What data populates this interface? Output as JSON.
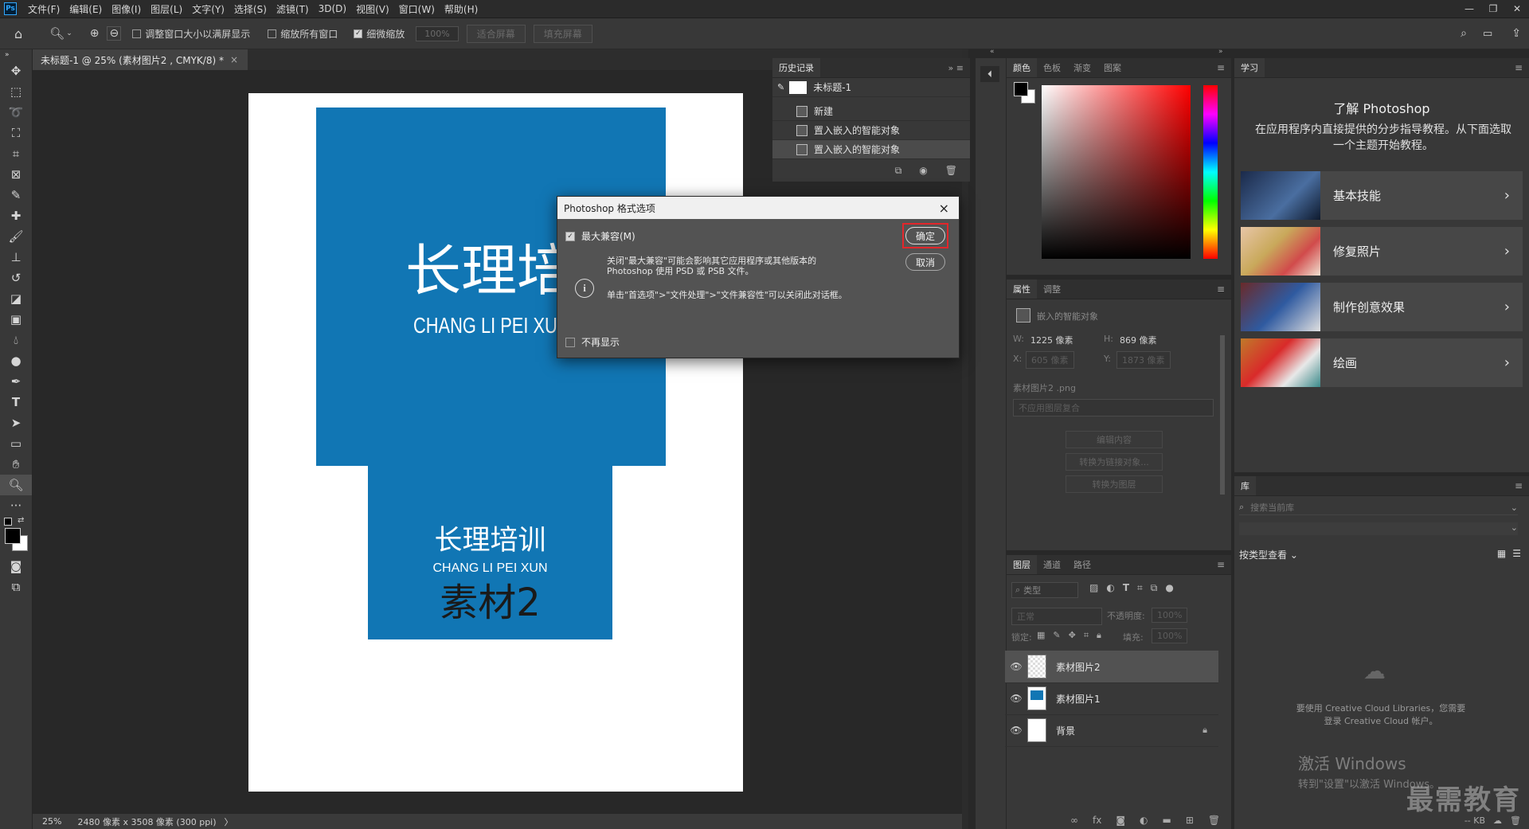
{
  "menubar": {
    "logo": "Ps",
    "items": [
      "文件(F)",
      "编辑(E)",
      "图像(I)",
      "图层(L)",
      "文字(Y)",
      "选择(S)",
      "滤镜(T)",
      "3D(D)",
      "视图(V)",
      "窗口(W)",
      "帮助(H)"
    ]
  },
  "options": {
    "resize_windows": "调整窗口大小以满屏显示",
    "zoom_all": "缩放所有窗口",
    "scrubby_zoom": "细微缩放",
    "zoom_percent": "100%",
    "fit_screen": "适合屏幕",
    "fill_screen": "填充屏幕"
  },
  "document": {
    "tab_title": "未标题-1 @ 25% (素材图片2 , CMYK/8) *",
    "close": "×",
    "image1": {
      "title": "长理培训",
      "subtitle": "CHANG LI PEI XUN"
    },
    "image2": {
      "title": "长理培训",
      "subtitle": "CHANG LI PEI XUN",
      "label": "素材2"
    },
    "colors": {
      "image_blue": "#1176b4",
      "page": "#ffffff"
    }
  },
  "statusbar": {
    "zoom": "25%",
    "info": "2480 像素 x 3508 像素 (300 ppi)",
    "arrow": "〉"
  },
  "history": {
    "tab": "历史记录",
    "snapshot": "未标题-1",
    "items": [
      {
        "label": "新建"
      },
      {
        "label": "置入嵌入的智能对象"
      },
      {
        "label": "置入嵌入的智能对象"
      }
    ]
  },
  "color_panel": {
    "tabs": [
      "颜色",
      "色板",
      "渐变",
      "图案"
    ]
  },
  "properties": {
    "tabs": [
      "属性",
      "调整"
    ],
    "type": "嵌入的智能对象",
    "w_label": "W:",
    "w": "1225 像素",
    "h_label": "H:",
    "h": "869 像素",
    "x_label": "X:",
    "x": "605 像素",
    "y_label": "Y:",
    "y": "1873 像素",
    "file": "素材图片2 .png",
    "comp": "不应用图层复合",
    "edit_btn": "编辑内容",
    "link_btn": "转换为链接对象...",
    "layer_btn": "转换为图层"
  },
  "layers": {
    "tabs": [
      "图层",
      "通道",
      "路径"
    ],
    "filter": "类型",
    "blend": "正常",
    "opacity_label": "不透明度:",
    "opacity": "100%",
    "lock_label": "锁定:",
    "fill_label": "填充:",
    "fill": "100%",
    "items": [
      {
        "name": "素材图片2"
      },
      {
        "name": "素材图片1"
      },
      {
        "name": "背景"
      }
    ]
  },
  "learn": {
    "tab": "学习",
    "heading": "了解 Photoshop",
    "desc": "在应用程序内直接提供的分步指导教程。从下面选取一个主题开始教程。",
    "cards": [
      {
        "title": "基本技能"
      },
      {
        "title": "修复照片"
      },
      {
        "title": "制作创意效果"
      },
      {
        "title": "绘画"
      }
    ]
  },
  "library": {
    "tab": "库",
    "search_placeholder": "搜索当前库",
    "view_by": "按类型查看",
    "cc_msg": "要使用 Creative Cloud Libraries，您需要登录 Creative Cloud 帐户。",
    "kb": "-- KB"
  },
  "watermark": {
    "activate": "激活 Windows",
    "activate_sub": "转到\"设置\"以激活 Windows。",
    "brand": "最需教育"
  },
  "dialog": {
    "title": "Photoshop 格式选项",
    "close": "×",
    "checkbox": "最大兼容(M)",
    "text1": "关闭\"最大兼容\"可能会影响其它应用程序或其他版本的 Photoshop 使用 PSD 或 PSB 文件。",
    "text2": "单击\"首选项\">\"文件处理\">\"文件兼容性\"可以关闭此对话框。",
    "ok": "确定",
    "cancel": "取消",
    "dont_show": "不再显示",
    "highlight_color": "#e3262b"
  }
}
